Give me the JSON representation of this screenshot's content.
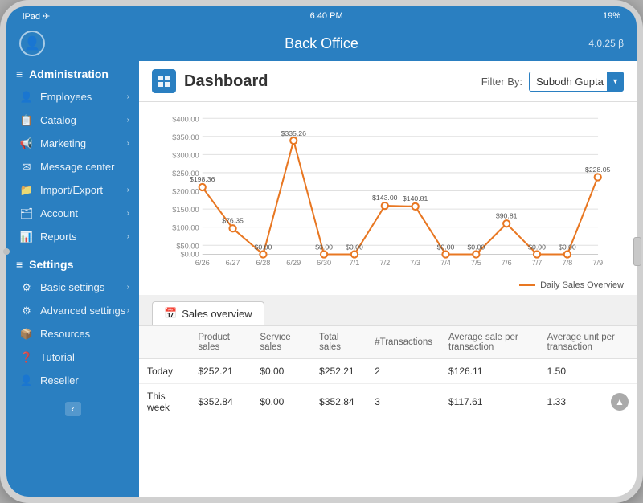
{
  "device": {
    "status_bar": {
      "left": "iPad ✈",
      "center": "6:40 PM",
      "right": "19%"
    },
    "nav_bar": {
      "title": "Back Office",
      "version": "4.0.25 β"
    }
  },
  "sidebar": {
    "admin_section": "Administration",
    "items": [
      {
        "label": "Employees",
        "has_chevron": true,
        "icon": "👤"
      },
      {
        "label": "Catalog",
        "has_chevron": true,
        "icon": "📋"
      },
      {
        "label": "Marketing",
        "has_chevron": true,
        "icon": "📢"
      },
      {
        "label": "Message center",
        "has_chevron": false,
        "icon": "✉"
      },
      {
        "label": "Import/Export",
        "has_chevron": true,
        "icon": "📁"
      },
      {
        "label": "Account",
        "has_chevron": true,
        "icon": "🗂"
      },
      {
        "label": "Reports",
        "has_chevron": true,
        "icon": "📊"
      }
    ],
    "settings_section": "Settings",
    "settings_items": [
      {
        "label": "Basic settings",
        "has_chevron": true,
        "icon": "⚙"
      },
      {
        "label": "Advanced settings",
        "has_chevron": true,
        "icon": "⚙"
      },
      {
        "label": "Resources",
        "has_chevron": false,
        "icon": "📦"
      },
      {
        "label": "Tutorial",
        "has_chevron": false,
        "icon": "❓"
      },
      {
        "label": "Reseller",
        "has_chevron": false,
        "icon": "👤"
      }
    ],
    "collapse_btn": "‹"
  },
  "main": {
    "header": {
      "title": "Dashboard",
      "filter_label": "Filter By:",
      "filter_value": "Subodh Gupta"
    },
    "chart": {
      "y_labels": [
        "$400.00",
        "$350.00",
        "$300.00",
        "$250.00",
        "$200.00",
        "$150.00",
        "$100.00",
        "$50.00",
        "$0.00"
      ],
      "x_labels": [
        "6/26",
        "6/27",
        "6/28",
        "6/29",
        "6/30",
        "7/1",
        "7/2",
        "7/3",
        "7/4",
        "7/5",
        "7/6",
        "7/7",
        "7/8",
        "7/9"
      ],
      "data_points": [
        {
          "x": "6/26",
          "y": 198.36,
          "label": "$198.36"
        },
        {
          "x": "6/27",
          "y": 76.35,
          "label": "$76.35"
        },
        {
          "x": "6/28",
          "y": 0.0,
          "label": "$0.00"
        },
        {
          "x": "6/29",
          "y": 335.26,
          "label": "$335.26"
        },
        {
          "x": "6/30",
          "y": 0.0,
          "label": "$0.00"
        },
        {
          "x": "7/1",
          "y": 0.0,
          "label": "$0.00"
        },
        {
          "x": "7/2",
          "y": 143.0,
          "label": "$143.00"
        },
        {
          "x": "7/3",
          "y": 140.81,
          "label": "$140.81"
        },
        {
          "x": "7/4",
          "y": 0.0,
          "label": "$0.00"
        },
        {
          "x": "7/5",
          "y": 0.0,
          "label": "$0.00"
        },
        {
          "x": "7/6",
          "y": 90.81,
          "label": "$90.81"
        },
        {
          "x": "7/7",
          "y": 0.0,
          "label": "$0.00"
        },
        {
          "x": "7/8",
          "y": 0.0,
          "label": "$0.00"
        },
        {
          "x": "7/9",
          "y": 228.05,
          "label": "$228.05"
        }
      ],
      "legend": "Daily Sales Overview",
      "max_y": 400
    },
    "tab": "Sales overview",
    "table": {
      "headers": [
        "",
        "Product sales",
        "Service sales",
        "Total sales",
        "#Transactions",
        "Average sale per transaction",
        "Average unit per transaction"
      ],
      "rows": [
        {
          "period": "Today",
          "product_sales": "$252.21",
          "service_sales": "$0.00",
          "total_sales": "$252.21",
          "transactions": "2",
          "avg_sale": "$126.11",
          "avg_unit": "1.50"
        },
        {
          "period": "This week",
          "product_sales": "$352.84",
          "service_sales": "$0.00",
          "total_sales": "$352.84",
          "transactions": "3",
          "avg_sale": "$117.61",
          "avg_unit": "1.33"
        }
      ]
    }
  }
}
